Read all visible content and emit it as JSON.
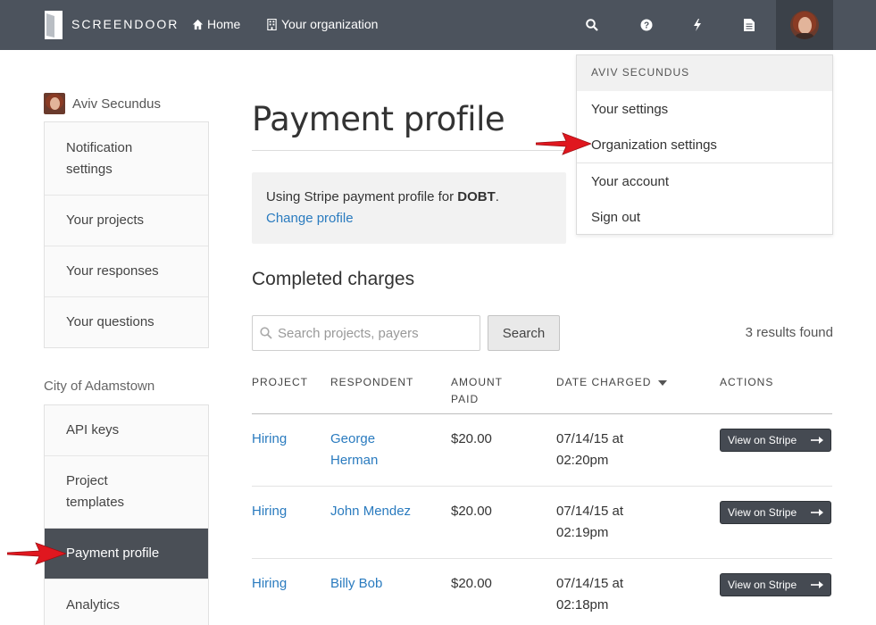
{
  "topbar": {
    "brand": "SCREENDOOR",
    "nav": [
      {
        "label": "Home",
        "icon": "home-icon"
      },
      {
        "label": "Your organization",
        "icon": "building-icon"
      }
    ],
    "icons": [
      "search-icon",
      "help-icon",
      "bolt-icon",
      "document-icon",
      "avatar"
    ]
  },
  "sidebar": {
    "user_name": "Aviv Secundus",
    "user_items": [
      {
        "label": "Notification settings"
      },
      {
        "label": "Your projects"
      },
      {
        "label": "Your responses"
      },
      {
        "label": "Your questions"
      }
    ],
    "org_name": "City of Adamstown",
    "org_items": [
      {
        "label": "API keys"
      },
      {
        "label": "Project templates"
      },
      {
        "label": "Payment profile",
        "active": true
      },
      {
        "label": "Analytics"
      }
    ]
  },
  "main": {
    "title": "Payment profile",
    "info_prefix": "Using Stripe payment profile for ",
    "info_org": "DOBT",
    "info_suffix": ".",
    "change_link": "Change profile",
    "section_title": "Completed charges",
    "search_placeholder": "Search projects, payers",
    "search_button": "Search",
    "results_text": "3 results found",
    "columns": {
      "project": "PROJECT",
      "respondent": "RESPONDENT",
      "amount_1": "AMOUNT",
      "amount_2": "PAID",
      "date": "DATE CHARGED",
      "actions": "ACTIONS"
    },
    "rows": [
      {
        "project": "Hiring",
        "respondent_1": "George",
        "respondent_2": "Herman",
        "amount": "$20.00",
        "date_1": "07/14/15 at",
        "date_2": "02:20pm",
        "action": "View on Stripe"
      },
      {
        "project": "Hiring",
        "respondent_1": "John Mendez",
        "respondent_2": "",
        "amount": "$20.00",
        "date_1": "07/14/15 at",
        "date_2": "02:19pm",
        "action": "View on Stripe"
      },
      {
        "project": "Hiring",
        "respondent_1": "Billy Bob",
        "respondent_2": "",
        "amount": "$20.00",
        "date_1": "07/14/15 at",
        "date_2": "02:18pm",
        "action": "View on Stripe"
      }
    ]
  },
  "dropdown": {
    "header": "AVIV SECUNDUS",
    "items": [
      "Your settings",
      "Organization settings",
      "Your account",
      "Sign out"
    ]
  },
  "colors": {
    "topbar": "#4c535d",
    "link": "#2a7bbf",
    "active_item": "#4a4f56",
    "annotation_arrow": "#e0171f"
  }
}
